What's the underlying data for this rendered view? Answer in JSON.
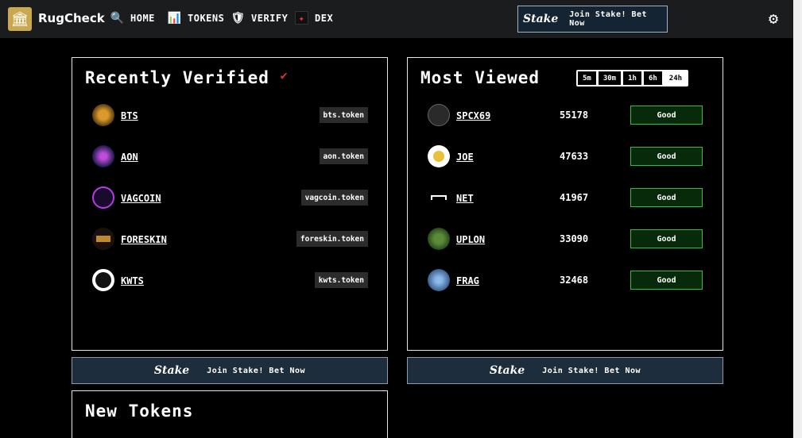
{
  "nav": {
    "logo_text": "RugCheck",
    "items": [
      {
        "label": "HOME",
        "icon": "search-icon"
      },
      {
        "label": "TOKENS",
        "icon": "chart-icon"
      },
      {
        "label": "VERIFY",
        "icon": "shield-icon"
      },
      {
        "label": "DEX",
        "icon": "dex-icon"
      }
    ],
    "stake_logo": "Stake",
    "stake_text": "Join Stake! Bet Now"
  },
  "recently_verified": {
    "title": "Recently Verified",
    "tokens": [
      {
        "name": "BTS",
        "badge": "bts.token"
      },
      {
        "name": "AON",
        "badge": "aon.token"
      },
      {
        "name": "VAGCOIN",
        "badge": "vagcoin.token"
      },
      {
        "name": "FORESKIN",
        "badge": "foreskin.token"
      },
      {
        "name": "KWTS",
        "badge": "kwts.token"
      }
    ]
  },
  "most_viewed": {
    "title": "Most Viewed",
    "filters": [
      "5m",
      "30m",
      "1h",
      "6h",
      "24h"
    ],
    "active_filter": "24h",
    "tokens": [
      {
        "name": "SPCX69",
        "views": "55178",
        "status": "Good"
      },
      {
        "name": "JOE",
        "views": "47633",
        "status": "Good"
      },
      {
        "name": "NET",
        "views": "41967",
        "status": "Good"
      },
      {
        "name": "UPLON",
        "views": "33090",
        "status": "Good"
      },
      {
        "name": "FRAG",
        "views": "32468",
        "status": "Good"
      }
    ]
  },
  "stake_banners": [
    {
      "logo": "Stake",
      "text": "Join Stake! Bet Now"
    },
    {
      "logo": "Stake",
      "text": "Join Stake! Bet Now"
    }
  ],
  "new_tokens": {
    "title": "New Tokens"
  },
  "colors": {
    "good_border": "#2fbf3f",
    "panel_border": "#e6e6e6",
    "stake_bg": "#1e2d3b"
  }
}
